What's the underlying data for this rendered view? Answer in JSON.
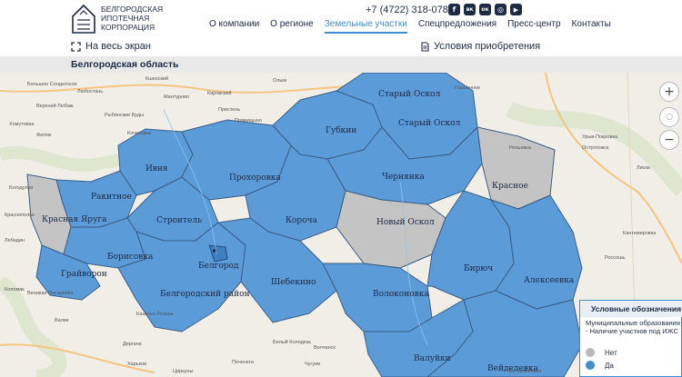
{
  "logo": {
    "lines": [
      "БЕЛГОРОДСКАЯ",
      "ИПОТЕЧНАЯ",
      "КОРПОРАЦИЯ"
    ]
  },
  "header": {
    "phone": "+7 (4722) 318-078",
    "socials": [
      {
        "icon": "facebook-icon",
        "glyph": "f"
      },
      {
        "icon": "vk-icon",
        "glyph": "вк"
      },
      {
        "icon": "odnoklassniki-icon",
        "glyph": "ок"
      },
      {
        "icon": "instagram-icon",
        "glyph": "◎"
      },
      {
        "icon": "youtube-icon",
        "glyph": "▶"
      }
    ],
    "nav": [
      {
        "label": "О компании",
        "active": false
      },
      {
        "label": "О регионе",
        "active": false
      },
      {
        "label": "Земельные участки",
        "active": true
      },
      {
        "label": "Спецпредложения",
        "active": false
      },
      {
        "label": "Пресс-центр",
        "active": false
      },
      {
        "label": "Контакты",
        "active": false
      }
    ]
  },
  "toolbar": {
    "fullscreen_label": "На весь экран",
    "conditions_label": "Условия приобретения"
  },
  "region_title": "Белгородская область",
  "map": {
    "zoom_in": "+",
    "zoom_out": "−",
    "districts": [
      {
        "name": "Старый Оскол",
        "has_plots": true
      },
      {
        "name": "Старый Оскол",
        "has_plots": true
      },
      {
        "name": "Губкин",
        "has_plots": true
      },
      {
        "name": "Ивня",
        "has_plots": true
      },
      {
        "name": "Прохоровка",
        "has_plots": true
      },
      {
        "name": "Чернянка",
        "has_plots": true
      },
      {
        "name": "Ракитное",
        "has_plots": true
      },
      {
        "name": "Красная Яруга",
        "has_plots": false
      },
      {
        "name": "Строитель",
        "has_plots": true
      },
      {
        "name": "Короча",
        "has_plots": true
      },
      {
        "name": "Новый Оскол",
        "has_plots": false
      },
      {
        "name": "Красное",
        "has_plots": false
      },
      {
        "name": "Борисовка",
        "has_plots": true
      },
      {
        "name": "Белгород",
        "has_plots": true
      },
      {
        "name": "Грайворон",
        "has_plots": true
      },
      {
        "name": "Шебекино",
        "has_plots": true
      },
      {
        "name": "Белгородский район",
        "has_plots": true
      },
      {
        "name": "Волоконовка",
        "has_plots": true
      },
      {
        "name": "Бирюч",
        "has_plots": true
      },
      {
        "name": "Алексеевка",
        "has_plots": true
      },
      {
        "name": "Валуйки",
        "has_plots": true
      },
      {
        "name": "Вейделевка",
        "has_plots": true
      }
    ],
    "villages": [
      "Большое Солдатское",
      "Любостань",
      "Кшенский",
      "Мантурово",
      "Кировский",
      "Олым",
      "Рыбинские Буды",
      "Пристень",
      "Прямицыно",
      "Горшечное",
      "Верхний Любаж",
      "Хомутовка",
      "Фатеж",
      "Кочетовка",
      "Репьевка",
      "Острогожск",
      "Урыв-Покровка",
      "Лиски",
      "Россошь",
      "Кантемировка",
      "Краснополье",
      "Лебедин",
      "Богодухов",
      "Коломак",
      "Великая Писаревка",
      "Казачья Лопань",
      "Валки",
      "Дергачи",
      "Харьков",
      "Циркуны",
      "Печенеги",
      "Чугуев",
      "Белый Колодезь",
      "Волчанск",
      "Бутурлиновка"
    ]
  },
  "legend": {
    "title": "Условные обозначения",
    "subtitle": "Муниципальные образования - Наличие участков под ИЖС",
    "items": [
      {
        "label": "Нет",
        "color": "#b9b9b9"
      },
      {
        "label": "Да",
        "color": "#3d8fd1"
      }
    ]
  },
  "colors": {
    "accent": "#3d8fd1",
    "district_yes": "#5b9bd8",
    "district_no": "#c4c4c4",
    "text_dark": "#1d2a44"
  }
}
